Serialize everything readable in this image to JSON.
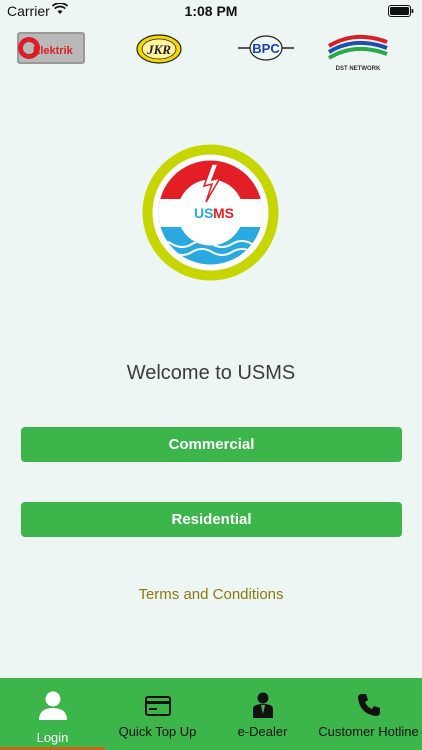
{
  "status_bar": {
    "carrier": "Carrier",
    "time": "1:08 PM",
    "icons": [
      "wifi-icon",
      "battery-icon"
    ]
  },
  "partner_logos": [
    {
      "name": "elektrik-logo",
      "text": "Elektrik"
    },
    {
      "name": "jkr-logo",
      "text": "JKR"
    },
    {
      "name": "bpc-logo",
      "text": "BPC"
    },
    {
      "name": "dst-network-logo",
      "text": "DST NETWORK"
    }
  ],
  "emblem": {
    "text_us": "US",
    "text_ms": "MS"
  },
  "welcome_text": "Welcome to USMS",
  "buttons": {
    "commercial": "Commercial",
    "residential": "Residential"
  },
  "terms_link": "Terms and Conditions",
  "tabs": [
    {
      "label": "Login",
      "icon": "person-icon",
      "active": true
    },
    {
      "label": "Quick Top Up",
      "icon": "card-icon",
      "active": false
    },
    {
      "label": "e-Dealer",
      "icon": "dealer-icon",
      "active": false
    },
    {
      "label": "Customer Hotline",
      "icon": "phone-icon",
      "active": false
    }
  ],
  "colors": {
    "background": "#edf6f2",
    "primary_green": "#3cb54b",
    "terms_text": "#8a7a12",
    "emblem_red": "#e31e24",
    "emblem_blue": "#29a9e0",
    "emblem_ring": "#c7d600"
  }
}
